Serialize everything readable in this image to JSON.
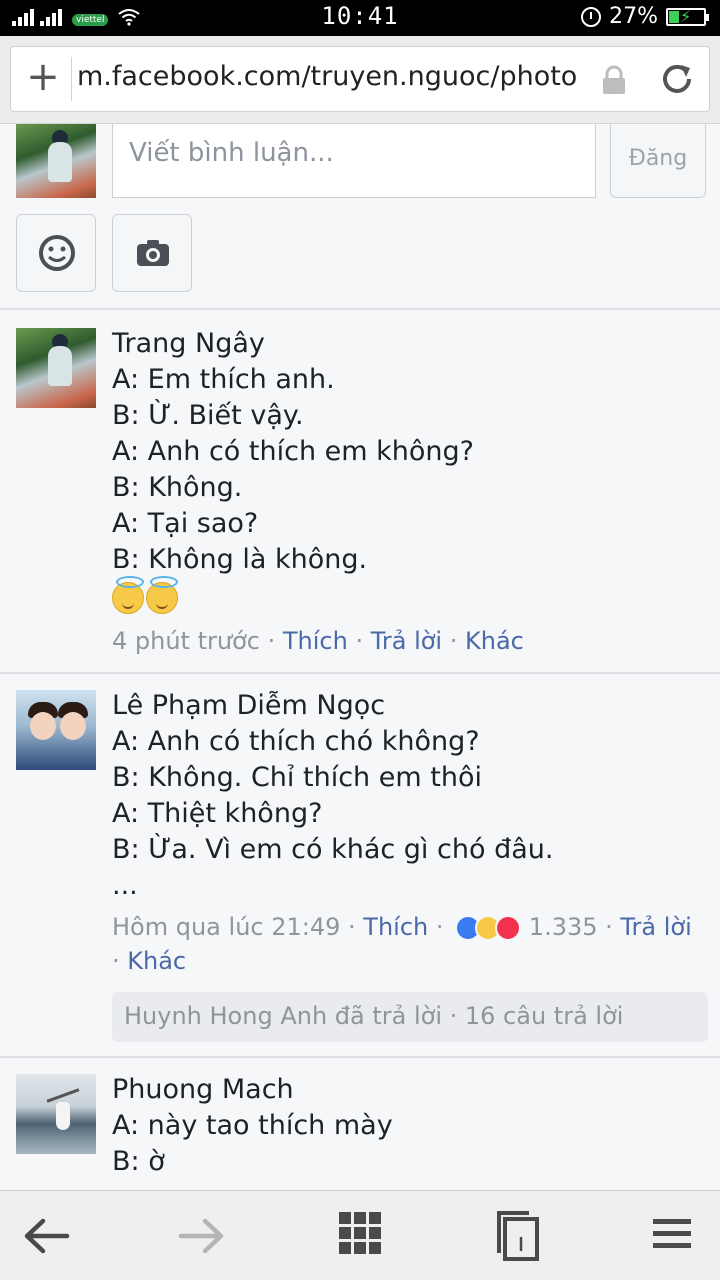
{
  "status_bar": {
    "carrier": "viettel",
    "time": "10:41",
    "battery": "27%"
  },
  "browser": {
    "url": "m.facebook.com/truyen.nguoc/photo"
  },
  "composer": {
    "placeholder": "Viết bình luận...",
    "post_label": "Đăng"
  },
  "comments": [
    {
      "author": "Trang Ngây",
      "lines": [
        "A: Em thích anh.",
        "B: Ừ. Biết vậy.",
        "A: Anh có thích em không?",
        "B: Không.",
        "A: Tại sao?",
        "B: Không là không."
      ],
      "time": "4 phút trước",
      "like": "Thích",
      "reply": "Trả lời",
      "more": "Khác"
    },
    {
      "author": "Lê Phạm Diễm Ngọc",
      "lines": [
        "A: Anh có thích chó không?",
        "B: Không. Chỉ thích em thôi",
        "A: Thiệt không?",
        "B: Ừa. Vì em có khác gì chó đâu.",
        "..."
      ],
      "time": "Hôm qua lúc 21:49",
      "like": "Thích",
      "reaction_count": "1.335",
      "reply": "Trả lời",
      "more": "Khác",
      "reply_summary": "Huynh Hong Anh đã trả lời · 16 câu trả lời"
    },
    {
      "author": "Phuong Mach",
      "lines": [
        "A: này tao thích mày",
        "B: ờ"
      ]
    }
  ],
  "colors": {
    "link": "#4b68a8",
    "meta": "#90949c",
    "background": "#f6f7f9"
  }
}
